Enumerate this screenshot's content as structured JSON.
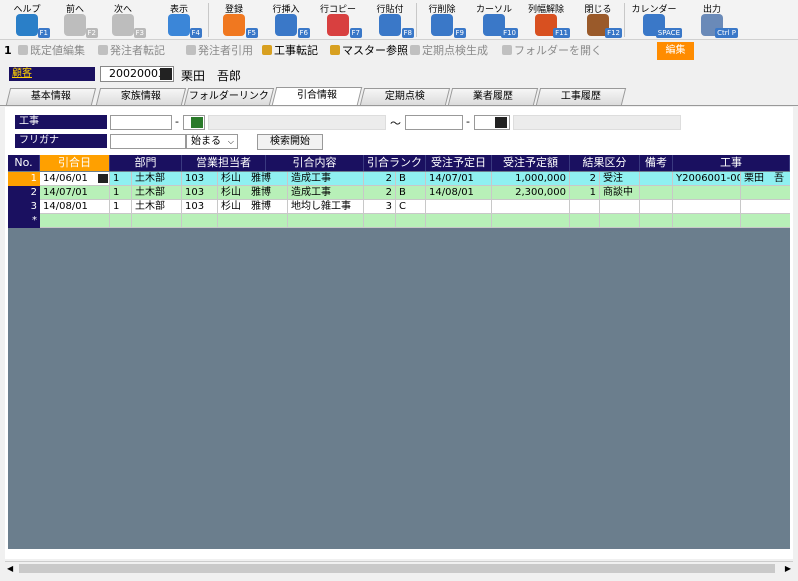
{
  "toolbar": {
    "buttons": [
      {
        "label": "ヘルプ",
        "key": "F1",
        "icon": "help-icon",
        "color": "#2a7fc8"
      },
      {
        "label": "前へ",
        "key": "F2",
        "icon": "arrow-left-icon",
        "color": "#bdbdbd"
      },
      {
        "label": "次へ",
        "key": "F3",
        "icon": "arrow-right-icon",
        "color": "#bdbdbd"
      },
      {
        "label": "表示",
        "key": "F4",
        "icon": "magnifier-icon",
        "color": "#3b86d8"
      },
      {
        "label": "登録",
        "key": "F5",
        "icon": "ok-icon",
        "color": "#f07820"
      },
      {
        "label": "行挿入",
        "key": "F6",
        "icon": "row-insert-icon",
        "color": "#3a78c8"
      },
      {
        "label": "行コピー",
        "key": "F7",
        "icon": "row-copy-icon",
        "color": "#d84040"
      },
      {
        "label": "行貼付",
        "key": "F8",
        "icon": "row-paste-icon",
        "color": "#3a78c8"
      },
      {
        "label": "行削除",
        "key": "F9",
        "icon": "row-delete-icon",
        "color": "#3a78c8"
      },
      {
        "label": "カーソル",
        "key": "F10",
        "icon": "cursor-icon",
        "color": "#3a78c8"
      },
      {
        "label": "列幅解除",
        "key": "F11",
        "icon": "column-width-icon",
        "color": "#d85020"
      },
      {
        "label": "閉じる",
        "key": "F12",
        "icon": "door-icon",
        "color": "#9a5a2a"
      },
      {
        "label": "カレンダー",
        "key": "SPACE",
        "icon": "calendar-icon",
        "color": "#3a78c8"
      },
      {
        "label": "出力",
        "key": "Ctrl P",
        "icon": "print-icon",
        "color": "#6a8ab8"
      }
    ]
  },
  "subbar": {
    "number": "1",
    "items": [
      {
        "label": "既定値編集",
        "icon": "edit-icon",
        "enabled": false
      },
      {
        "label": "発注者転記",
        "icon": "transfer-icon",
        "enabled": false
      },
      {
        "label": "発注者引用",
        "icon": "quote-icon",
        "enabled": false
      },
      {
        "label": "工事転記",
        "icon": "construction-transfer-icon",
        "enabled": true
      },
      {
        "label": "マスター参照",
        "icon": "master-search-icon",
        "enabled": true
      },
      {
        "label": "定期点検生成",
        "icon": "inspection-icon",
        "enabled": false
      },
      {
        "label": "フォルダーを開く",
        "icon": "folder-icon",
        "enabled": false
      }
    ],
    "edit_badge": "編集"
  },
  "customer": {
    "label": "顧客",
    "code": "20020003",
    "name": "栗田　吾郎"
  },
  "tabs": [
    {
      "label": "基本情報",
      "active": false
    },
    {
      "label": "家族情報",
      "active": false
    },
    {
      "label": "フォルダーリンク",
      "active": false
    },
    {
      "label": "引合情報",
      "active": true
    },
    {
      "label": "定期点検",
      "active": false
    },
    {
      "label": "業者履歴",
      "active": false
    },
    {
      "label": "工事履歴",
      "active": false
    }
  ],
  "filter": {
    "construction_label": "工事",
    "furigana_label": "フリガナ",
    "range_sep": "～",
    "dash": "-",
    "match_mode": "始まる",
    "search_button": "検索開始"
  },
  "grid": {
    "headers": [
      "No.",
      "引合日",
      "部門",
      "営業担当者",
      "引合内容",
      "引合ランク",
      "受注予定日",
      "受注予定額",
      "結果区分",
      "備考",
      "工事"
    ],
    "rows": [
      {
        "no": "1",
        "date": "14/06/01",
        "dept_code": "1",
        "dept": "土木部",
        "staff_code": "103",
        "staff": "杉山　雅博",
        "content": "造成工事",
        "rank_code": "2",
        "rank": "B",
        "order_date": "14/07/01",
        "amount": "1,000,000",
        "result_code": "2",
        "result": "受注",
        "note": "",
        "construction_code": "Y2006001-00",
        "construction": "栗田　吾",
        "current": true
      },
      {
        "no": "2",
        "date": "14/07/01",
        "dept_code": "1",
        "dept": "土木部",
        "staff_code": "103",
        "staff": "杉山　雅博",
        "content": "造成工事",
        "rank_code": "2",
        "rank": "B",
        "order_date": "14/08/01",
        "amount": "2,300,000",
        "result_code": "1",
        "result": "商談中",
        "note": "",
        "construction_code": "",
        "construction": "",
        "current": false
      },
      {
        "no": "3",
        "date": "14/08/01",
        "dept_code": "1",
        "dept": "土木部",
        "staff_code": "103",
        "staff": "杉山　雅博",
        "content": "地均し雑工事",
        "rank_code": "3",
        "rank": "C",
        "order_date": "",
        "amount": "",
        "result_code": "",
        "result": "",
        "note": "",
        "construction_code": "",
        "construction": "",
        "current": false
      },
      {
        "no": "*",
        "date": "",
        "dept_code": "",
        "dept": "",
        "staff_code": "",
        "staff": "",
        "content": "",
        "rank_code": "",
        "rank": "",
        "order_date": "",
        "amount": "",
        "result_code": "",
        "result": "",
        "note": "",
        "construction_code": "",
        "construction": "",
        "current": false
      }
    ]
  },
  "colors": {
    "header_navy": "#1a1060",
    "selected_orange": "#ffa000",
    "row_current": "#8ff0f0",
    "row_green": "#b8f0b8",
    "row_white": "#ffffff",
    "grid_bg": "#6b7e8d"
  }
}
